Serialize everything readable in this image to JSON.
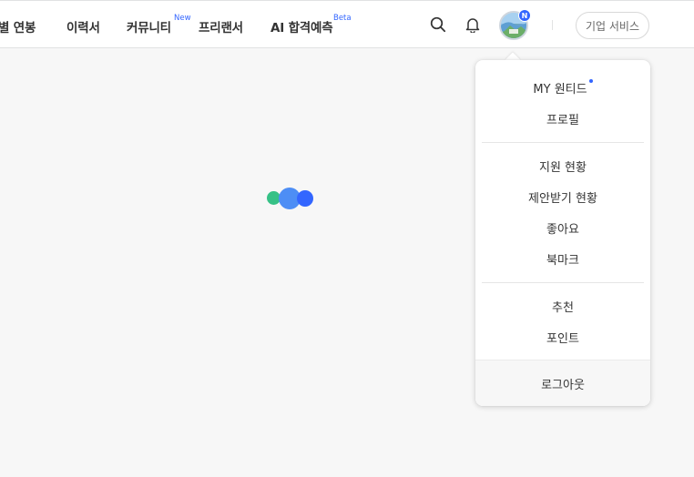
{
  "nav": {
    "items": [
      {
        "label": "별 연봉"
      },
      {
        "label": "이력서"
      },
      {
        "label": "커뮤니티",
        "badge": "New"
      },
      {
        "label": "프리랜서"
      },
      {
        "label": "AI 합격예측",
        "badge": "Beta"
      }
    ],
    "search_icon": "search-icon",
    "bell_icon": "bell-icon",
    "avatar_badge": "N",
    "business_button": "기업 서비스"
  },
  "dropdown": {
    "group1": [
      {
        "label": "MY 원티드",
        "has_dot": true
      },
      {
        "label": "프로필"
      }
    ],
    "group2": [
      {
        "label": "지원 현황"
      },
      {
        "label": "제안받기 현황"
      },
      {
        "label": "좋아요"
      },
      {
        "label": "북마크"
      }
    ],
    "group3": [
      {
        "label": "추천"
      },
      {
        "label": "포인트"
      }
    ],
    "logout": "로그아웃"
  },
  "colors": {
    "accent": "#3366ff",
    "loader": [
      "#36c186",
      "#4d8ef5",
      "#3366ff"
    ]
  }
}
